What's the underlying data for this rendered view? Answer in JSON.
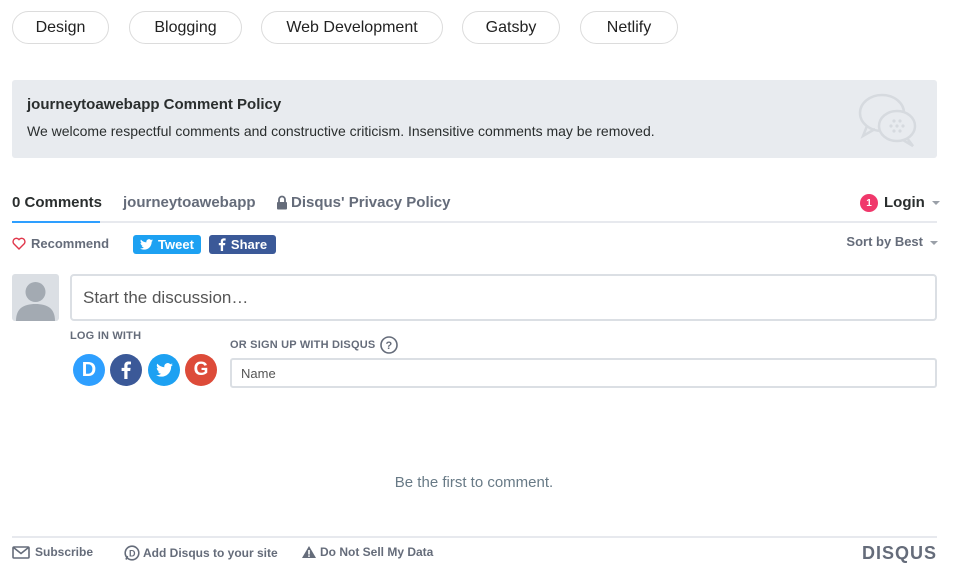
{
  "tags": [
    "Design",
    "Blogging",
    "Web Development",
    "Gatsby",
    "Netlify"
  ],
  "policy": {
    "title": "journeytoawebapp Comment Policy",
    "text": "We welcome respectful comments and constructive criticism. Insensitive comments may be removed."
  },
  "nav": {
    "comments": "0 Comments",
    "site": "journeytoawebapp",
    "privacy": "Disqus' Privacy Policy",
    "badge": "1",
    "login": "Login"
  },
  "actions": {
    "recommend": "Recommend",
    "tweet": "Tweet",
    "share": "Share",
    "sort": "Sort by Best"
  },
  "composer": {
    "placeholder": "Start the discussion…",
    "login_with": "LOG IN WITH",
    "signup": "OR SIGN UP WITH DISQUS",
    "name_placeholder": "Name"
  },
  "empty_message": "Be the first to comment.",
  "footer": {
    "subscribe": "Subscribe",
    "add": "Add Disqus to your site",
    "dnsmd": "Do Not Sell My Data",
    "brand": "DISQUS"
  },
  "colors": {
    "twitter": "#1da1f2",
    "facebook": "#3b5998",
    "disqus": "#2e9fff",
    "google": "#dd4b39",
    "badge": "#f0386b"
  }
}
